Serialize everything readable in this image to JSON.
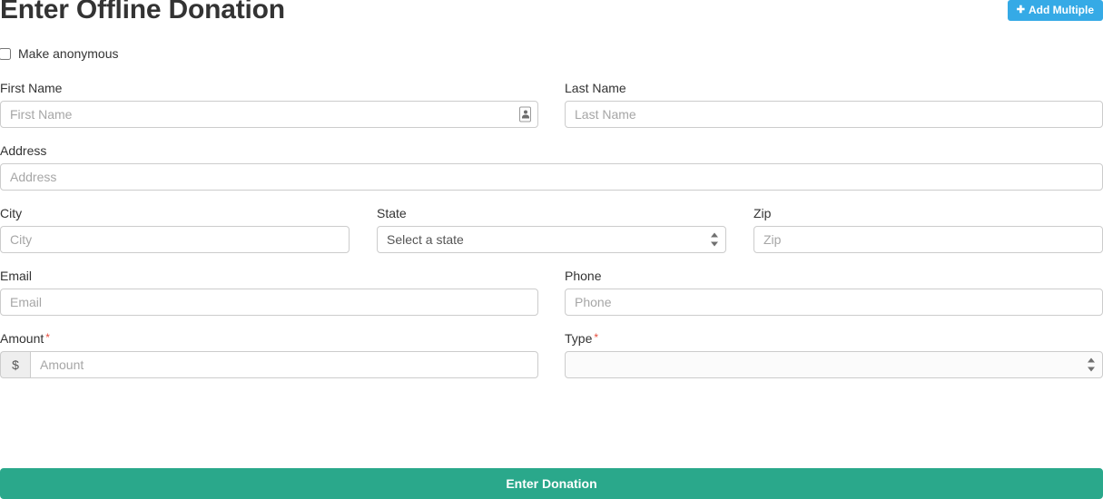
{
  "header": {
    "title": "Enter Offline Donation",
    "add_multiple_label": "Add Multiple",
    "add_multiple_icon": "plus-icon",
    "add_multiple_color": "#35aae6"
  },
  "anonymous": {
    "label": "Make anonymous",
    "checked": false
  },
  "fields": {
    "first_name": {
      "label": "First Name",
      "placeholder": "First Name",
      "value": "",
      "icon": "contact-card-autofill-icon"
    },
    "last_name": {
      "label": "Last Name",
      "placeholder": "Last Name",
      "value": ""
    },
    "address": {
      "label": "Address",
      "placeholder": "Address",
      "value": ""
    },
    "city": {
      "label": "City",
      "placeholder": "City",
      "value": ""
    },
    "state": {
      "label": "State",
      "selected": "Select a state",
      "options": [
        "Select a state"
      ]
    },
    "zip": {
      "label": "Zip",
      "placeholder": "Zip",
      "value": ""
    },
    "email": {
      "label": "Email",
      "placeholder": "Email",
      "value": ""
    },
    "phone": {
      "label": "Phone",
      "placeholder": "Phone",
      "value": ""
    },
    "amount": {
      "label": "Amount",
      "required_marker": "*",
      "currency_symbol": "$",
      "placeholder": "Amount",
      "value": ""
    },
    "type": {
      "label": "Type",
      "required_marker": "*",
      "selected": "",
      "options": [
        ""
      ]
    }
  },
  "submit": {
    "label": "Enter Donation",
    "color": "#2aa88b"
  }
}
